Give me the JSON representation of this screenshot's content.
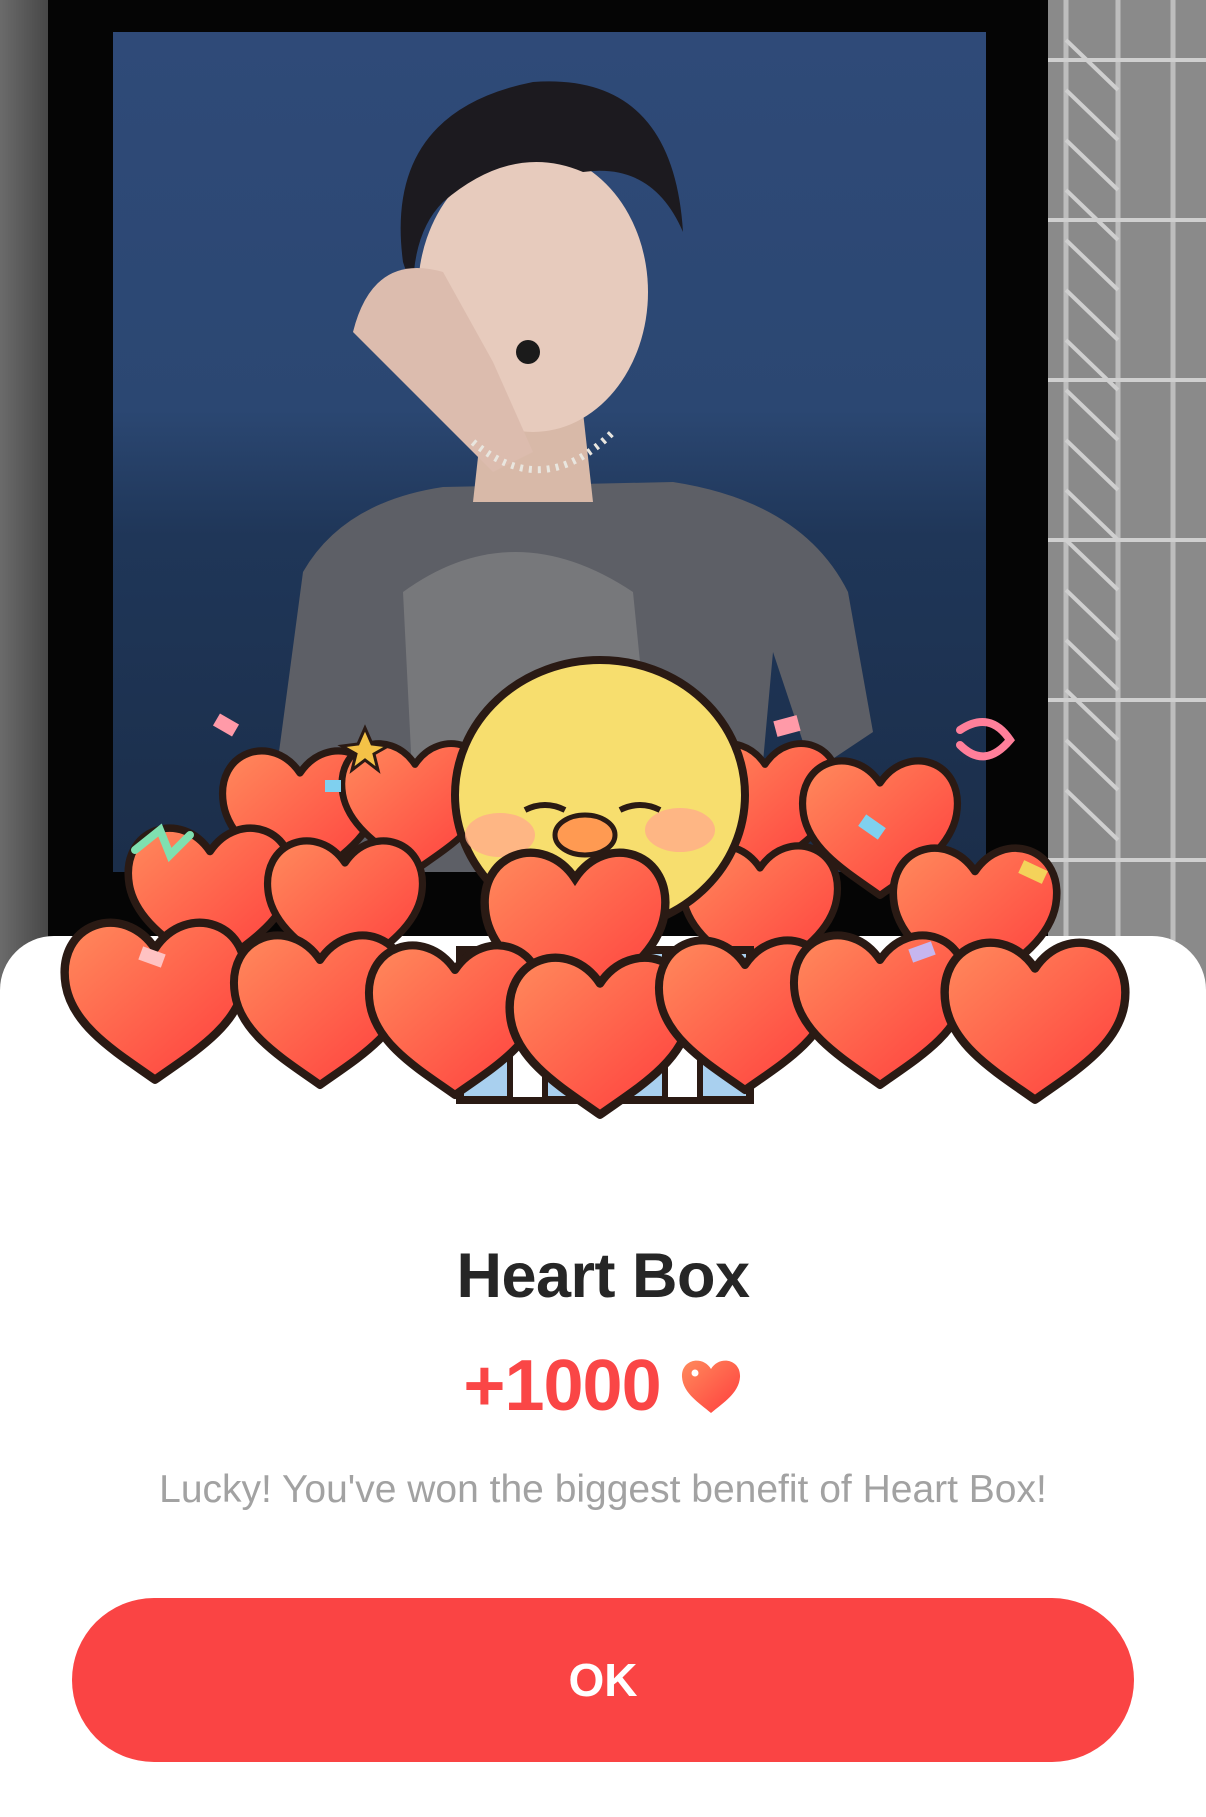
{
  "popup": {
    "title": "Heart Box",
    "reward_amount": "+1000",
    "reward_icon": "heart-icon",
    "message": "Lucky! You've won the biggest benefit of Heart Box!",
    "ok_label": "OK"
  },
  "colors": {
    "accent": "#fa4646",
    "button": "#fa4444",
    "title": "#262626",
    "message": "#a2a2a2",
    "heart_outline": "#2a1a14",
    "chick": "#f7de6e"
  }
}
